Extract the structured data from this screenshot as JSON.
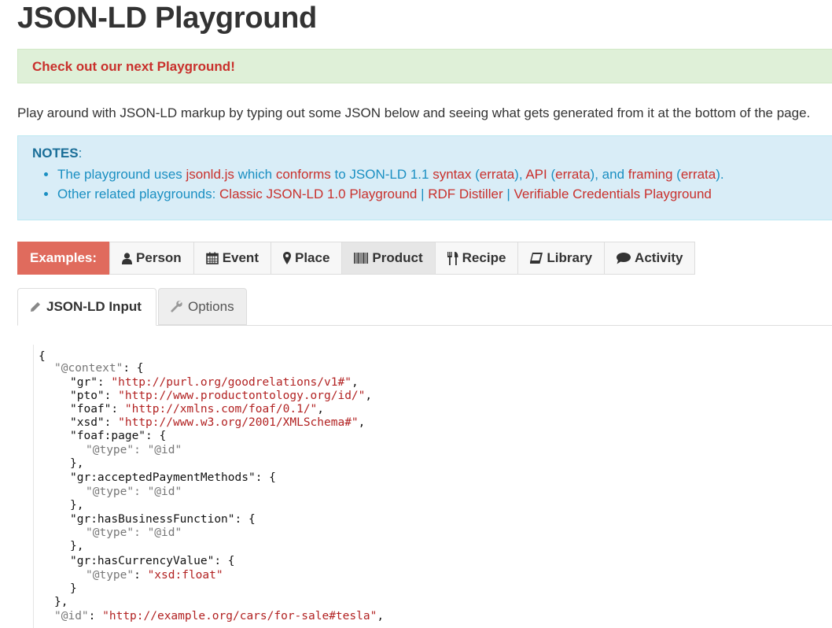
{
  "header": {
    "title": "JSON-LD Playground"
  },
  "announcement": {
    "link_text": "Check out our next Playground!"
  },
  "intro": "Play around with JSON-LD markup by typing out some JSON below and seeing what gets generated from it at the bottom of the page.",
  "notes": {
    "title": "NOTES",
    "colon": ":",
    "line1": {
      "t1": "The playground uses ",
      "jsonld_js": "jsonld.js",
      "t2": " which ",
      "conforms": "conforms",
      "t3": " to JSON-LD 1.1 ",
      "syntax": "syntax",
      "t4": " (",
      "errata1": "errata",
      "t5": "), ",
      "api": "API",
      "t6": " (",
      "errata2": "errata",
      "t7": "), and ",
      "framing": "framing",
      "t8": " (",
      "errata3": "errata",
      "t9": ")."
    },
    "line2": {
      "t1": "Other related playgrounds: ",
      "classic": "Classic JSON-LD 1.0 Playground",
      "sep": " | ",
      "rdf": "RDF Distiller",
      "vc": "Verifiable Credentials Playground"
    }
  },
  "examples": {
    "label": "Examples:",
    "items": [
      {
        "label": "Person",
        "icon": "user-icon"
      },
      {
        "label": "Event",
        "icon": "calendar-icon"
      },
      {
        "label": "Place",
        "icon": "map-marker-icon"
      },
      {
        "label": "Product",
        "icon": "barcode-icon",
        "active": true
      },
      {
        "label": "Recipe",
        "icon": "cutlery-icon"
      },
      {
        "label": "Library",
        "icon": "book-icon"
      },
      {
        "label": "Activity",
        "icon": "comment-icon"
      }
    ]
  },
  "tabs": {
    "input": "JSON-LD Input",
    "options": "Options"
  },
  "editor": {
    "lines": [
      [
        "{"
      ],
      [
        "\"@context\"",
        ": {"
      ],
      [
        "\"gr\"",
        ": ",
        "\"http://purl.org/goodrelations/v1#\"",
        ","
      ],
      [
        "\"pto\"",
        ": ",
        "\"http://www.productontology.org/id/\"",
        ","
      ],
      [
        "\"foaf\"",
        ": ",
        "\"http://xmlns.com/foaf/0.1/\"",
        ","
      ],
      [
        "\"xsd\"",
        ": ",
        "\"http://www.w3.org/2001/XMLSchema#\"",
        ","
      ],
      [
        "\"foaf:page\"",
        ": {"
      ],
      [
        "\"@type\"",
        ": ",
        "\"@id\""
      ],
      [
        "},"
      ],
      [
        "\"gr:acceptedPaymentMethods\"",
        ": {"
      ],
      [
        "\"@type\"",
        ": ",
        "\"@id\""
      ],
      [
        "},"
      ],
      [
        "\"gr:hasBusinessFunction\"",
        ": {"
      ],
      [
        "\"@type\"",
        ": ",
        "\"@id\""
      ],
      [
        "},"
      ],
      [
        "\"gr:hasCurrencyValue\"",
        ": {"
      ],
      [
        "\"@type\"",
        ": ",
        "\"xsd:float\""
      ],
      [
        "}"
      ],
      [
        "},"
      ],
      [
        "\"@id\"",
        ": ",
        "\"http://example.org/cars/for-sale#tesla\"",
        ","
      ]
    ]
  }
}
